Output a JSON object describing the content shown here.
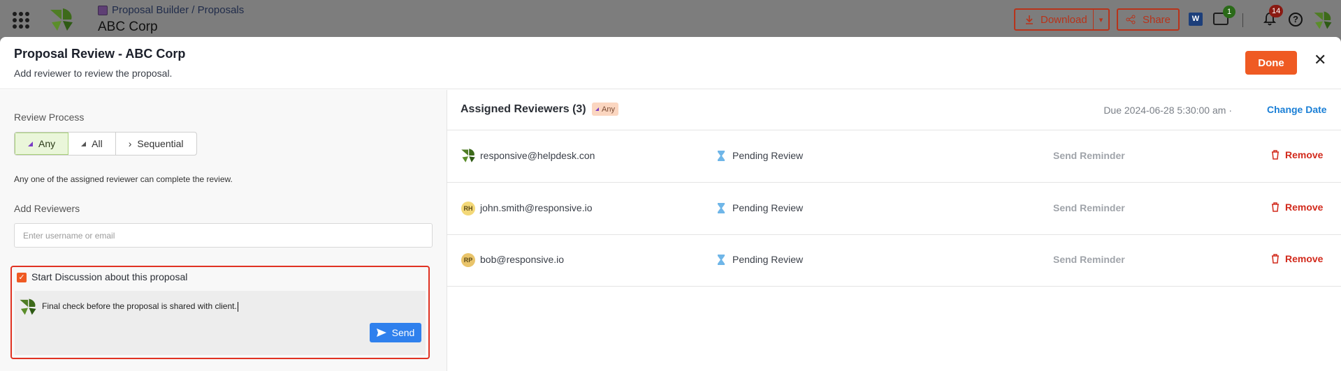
{
  "appbar": {
    "breadcrumb": "Proposal Builder / Proposals",
    "title": "ABC Corp",
    "download_label": "Download",
    "share_label": "Share",
    "word_label": "W",
    "chat_count": "1",
    "notif_count": "14",
    "help_label": "?"
  },
  "modal": {
    "title": "Proposal Review - ABC Corp",
    "subtitle": "Add reviewer to review the proposal.",
    "done_label": "Done",
    "close_label": "✕"
  },
  "left": {
    "review_process_label": "Review Process",
    "options": [
      "Any",
      "All",
      "Sequential"
    ],
    "selected_option": "Any",
    "option_note": "Any one of the assigned reviewer can complete the review.",
    "add_reviewers_label": "Add Reviewers",
    "add_placeholder": "Enter username or email",
    "discussion_checkbox_label": "Start Discussion about this proposal",
    "discussion_checked": true,
    "message_text": "Final check before the proposal is shared with client.",
    "send_label": "Send"
  },
  "right": {
    "title": "Assigned Reviewers (3)",
    "mode_badge": "Any",
    "due_text": "Due 2024-06-28 5:30:00 am ·",
    "change_date_label": "Change Date",
    "reviewers": [
      {
        "email": "responsive@helpdesk.con",
        "avatar": "",
        "status": "Pending Review",
        "reminder": "Send Reminder",
        "remove": "Remove"
      },
      {
        "email": "john.smith@responsive.io",
        "avatar": "RH",
        "status": "Pending Review",
        "reminder": "Send Reminder",
        "remove": "Remove"
      },
      {
        "email": "bob@responsive.io",
        "avatar": "RP",
        "status": "Pending Review",
        "reminder": "Send Reminder",
        "remove": "Remove"
      }
    ]
  },
  "colors": {
    "accent_orange": "#ef5a23",
    "link_blue": "#1a7fd6",
    "remove_red": "#d22a1c",
    "send_blue": "#2f80ed",
    "highlight_border": "#e03222"
  }
}
